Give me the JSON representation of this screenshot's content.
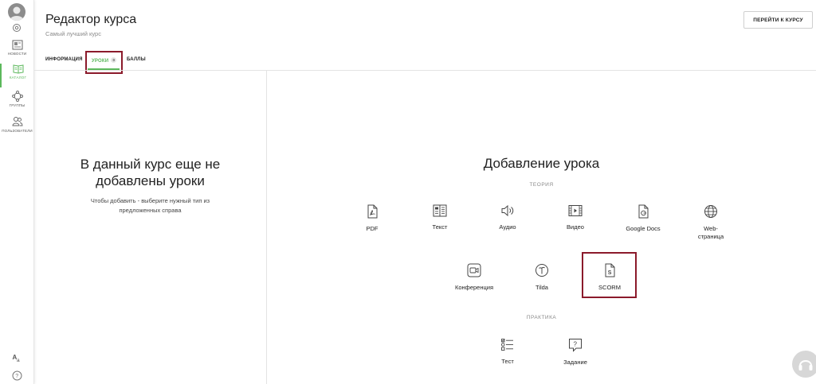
{
  "sidebar": {
    "items": [
      {
        "label": "НОВОСТИ",
        "icon": "news-icon"
      },
      {
        "label": "КАТАЛОГ",
        "icon": "catalog-icon"
      },
      {
        "label": "ГРУППЫ",
        "icon": "groups-icon"
      },
      {
        "label": "ПОЛЬЗОВАТЕЛИ",
        "icon": "users-icon"
      }
    ],
    "active_color": "#5cb85c"
  },
  "header": {
    "title": "Редактор курса",
    "subtitle": "Самый лучший курс",
    "goto_button": "ПЕРЕЙТИ К КУРСУ"
  },
  "tabs": [
    {
      "label": "ИНФОРМАЦИЯ"
    },
    {
      "label": "УРОКИ",
      "count": "0",
      "active": true
    },
    {
      "label": "БАЛЛЫ"
    }
  ],
  "left_panel": {
    "title": "В данный курс еще не добавлены уроки",
    "title_line1": "В данный курс еще не",
    "title_line2": "добавлены уроки",
    "desc_line1": "Чтобы добавить - выберите нужный тип из",
    "desc_line2": "предложенных справа"
  },
  "right_panel": {
    "title": "Добавление урока",
    "theory_label": "ТЕОРИЯ",
    "practice_label": "ПРАКТИКА",
    "theory_items": [
      {
        "label": "PDF",
        "icon": "pdf-icon"
      },
      {
        "label": "Текст",
        "icon": "text-icon"
      },
      {
        "label": "Аудио",
        "icon": "audio-icon"
      },
      {
        "label": "Видео",
        "icon": "video-icon"
      },
      {
        "label": "Google Docs",
        "icon": "google-docs-icon"
      },
      {
        "label_line1": "Web-",
        "label_line2": "страница",
        "icon": "web-page-icon"
      },
      {
        "label": "Конференция",
        "icon": "conference-icon"
      },
      {
        "label": "Tilda",
        "icon": "tilda-icon"
      },
      {
        "label": "SCORM",
        "icon": "scorm-icon"
      }
    ],
    "practice_items": [
      {
        "label": "Тест",
        "icon": "test-icon"
      },
      {
        "label": "Задание",
        "icon": "task-icon"
      }
    ]
  },
  "colors": {
    "accent": "#5cb85c",
    "highlight": "#8b1a2b"
  }
}
